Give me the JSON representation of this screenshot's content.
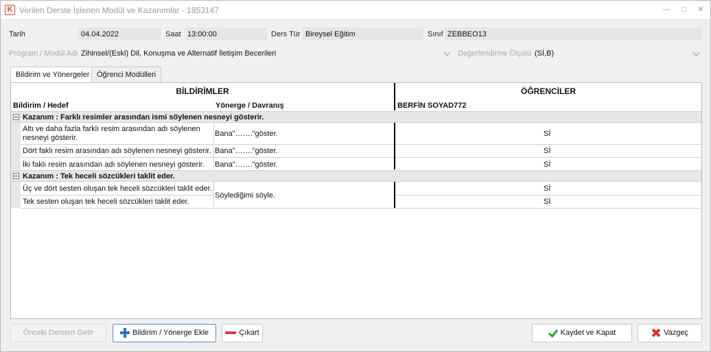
{
  "window": {
    "title": "Verilen Derste İşlenen Modül ve Kazanımlar - 1853147",
    "app_icon_glyph": "K",
    "minimize": "—",
    "maximize": "□",
    "close": "✕"
  },
  "form": {
    "date_label": "Tarih",
    "date_value": "04.04.2022",
    "time_label": "Saat",
    "time_value": "13:00:00",
    "lesson_type_label": "Ders Tür",
    "lesson_type_value": "Bireysel Eğitim",
    "class_label": "Sınıf",
    "class_value": "ZEBBEO13",
    "program_label": "Program / Modül Adı",
    "program_value": "Zihinsel/(Eski) Dil, Konuşma ve Alternatif İletişim Becerileri",
    "criterion_label": "Değerlendirme Ölçütü",
    "criterion_value": "(Sİ,B)"
  },
  "tabs": [
    {
      "label": "Bildirim ve Yönergeler",
      "active": true
    },
    {
      "label": "Öğrenci Modülleri",
      "active": false
    }
  ],
  "grid": {
    "band_left": "BİLDİRİMLER",
    "band_right": "ÖĞRENCİLER",
    "col_statement": "Bildirim / Hedef",
    "col_directive": "Yönerge / Davranış",
    "col_student": "BERFİN SOYAD772",
    "groups": [
      {
        "title": "Kazanım : Farklı resimler arasından ismi söylenen nesneyi gösterir.",
        "rows": [
          {
            "statement": "Altı ve daha fazla farklı resim arasından adı söylenen nesneyi gösterir.",
            "directive": "Bana\"…….\"göster.",
            "value": "Sİ"
          },
          {
            "statement": "Dört faklı resim arasından adı söylenen nesneyi gösterir.",
            "directive": "Bana\"…….\"göster.",
            "value": "Sİ"
          },
          {
            "statement": "İki faklı resim arasından adı söylenen nesneyi gösterir.",
            "directive": "Bana\"…….\"göster.",
            "value": "Sİ"
          }
        ]
      },
      {
        "title": "Kazanım : Tek heceli sözcükleri taklit eder.",
        "directive": "Söylediğimi söyle.",
        "rows": [
          {
            "statement": "Üç ve dört sesten oluşan tek heceli sözcükleri taklit eder.",
            "value": "Sİ"
          },
          {
            "statement": "Tek sesten oluşan tek heceli sözcükleri taklit eder.",
            "value": "Sİ"
          }
        ]
      }
    ]
  },
  "buttons": {
    "previous": "Önceki Dersten Getir",
    "add": "Bildirim / Yönerge Ekle",
    "remove": "Çıkart",
    "save": "Kaydet ve Kapat",
    "cancel": "Vazgeç"
  },
  "colors": {
    "accent_blue": "#2b6fd0",
    "remove_red": "#d83a3a",
    "save_green": "#2fa33a"
  }
}
